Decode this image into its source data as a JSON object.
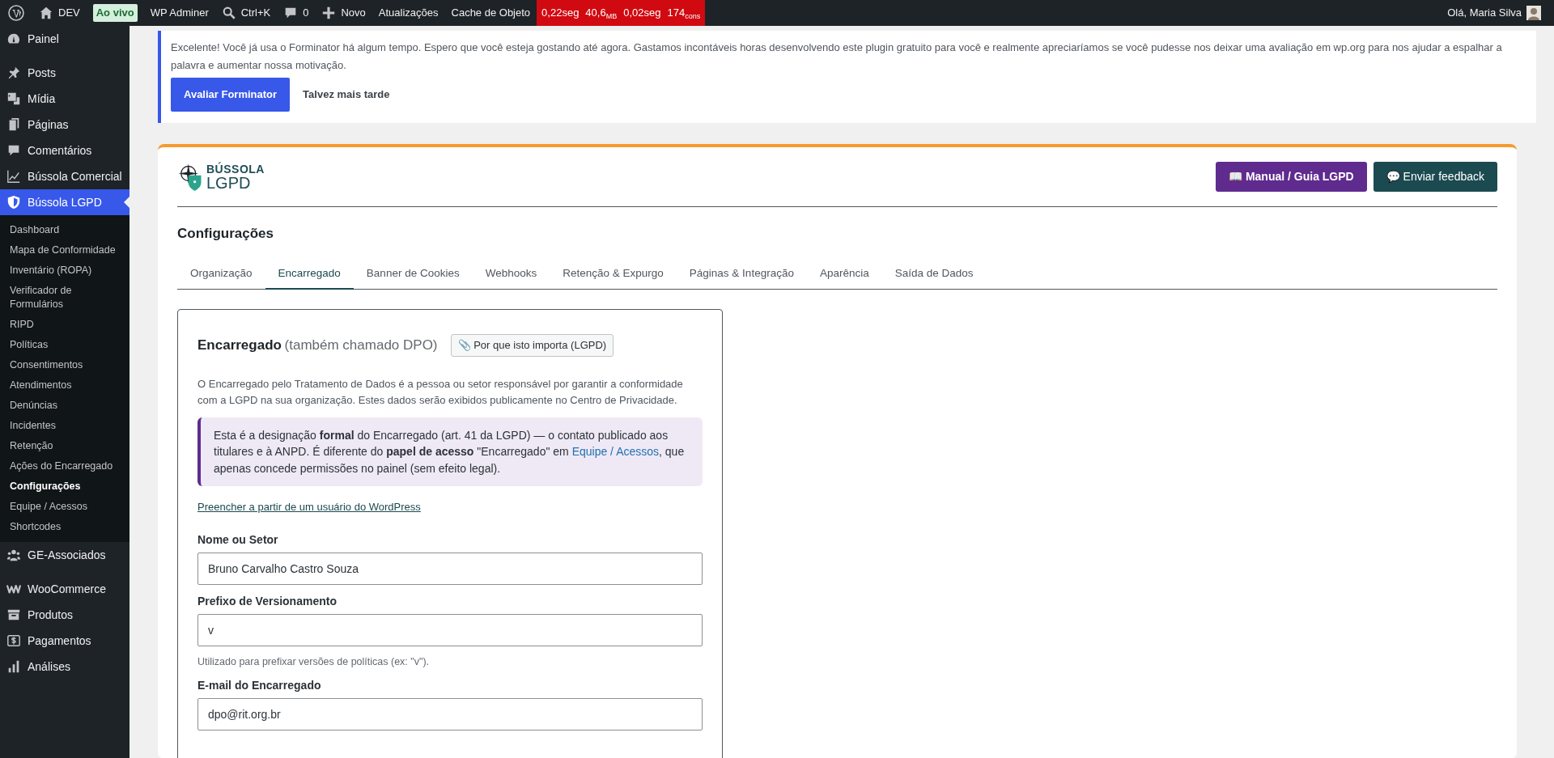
{
  "admin_bar": {
    "left": [
      {
        "kind": "wp-logo"
      },
      {
        "kind": "home",
        "label": "DEV"
      },
      {
        "kind": "badge",
        "label": "Ao vivo"
      },
      {
        "kind": "text",
        "label": "WP Adminer"
      },
      {
        "kind": "search",
        "label": "Ctrl+K"
      },
      {
        "kind": "comments",
        "label": "0"
      },
      {
        "kind": "new",
        "label": "Novo"
      },
      {
        "kind": "text",
        "label": "Atualizações"
      },
      {
        "kind": "text",
        "label": "Cache de Objeto"
      }
    ],
    "perf": [
      "0,22seg",
      "40,6$_{MB}$",
      "0,02seg",
      "174$_{cons}$"
    ],
    "greeting": "Olá, Maria Silva"
  },
  "sidebar": {
    "items": [
      {
        "label": "Painel",
        "selected": false
      },
      {
        "label": "Posts",
        "selected": false
      },
      {
        "label": "Mídia",
        "selected": false
      },
      {
        "label": "Páginas",
        "selected": false
      },
      {
        "label": "Comentários",
        "selected": false
      },
      {
        "label": "Bússola Comercial",
        "selected": false
      },
      {
        "label": "Bússola LGPD",
        "selected": true,
        "children": [
          {
            "label": "Dashboard",
            "selected": false
          },
          {
            "label": "Mapa de Conformidade",
            "selected": false
          },
          {
            "label": "Inventário (ROPA)",
            "selected": false
          },
          {
            "label": "Verificador de Formulários",
            "selected": false
          },
          {
            "label": "RIPD",
            "selected": false
          },
          {
            "label": "Políticas",
            "selected": false
          },
          {
            "label": "Consentimentos",
            "selected": false
          },
          {
            "label": "Atendimentos",
            "selected": false
          },
          {
            "label": "Denúncias",
            "selected": false
          },
          {
            "label": "Incidentes",
            "selected": false
          },
          {
            "label": "Retenção",
            "selected": false
          },
          {
            "label": "Ações do Encarregado",
            "selected": false
          },
          {
            "label": "Configurações",
            "selected": true
          },
          {
            "label": "Equipe / Acessos",
            "selected": false
          },
          {
            "label": "Shortcodes",
            "selected": false
          }
        ]
      },
      {
        "label": "GE-Associados",
        "selected": false
      },
      {
        "label": "WooCommerce",
        "selected": false
      },
      {
        "label": "Produtos",
        "selected": false
      },
      {
        "label": "Pagamentos",
        "selected": false
      },
      {
        "label": "Análises",
        "selected": false
      }
    ]
  },
  "notice": {
    "text": "Excelente! Você já usa o Forminator há algum tempo. Espero que você esteja gostando até agora. Gastamos incontáveis horas desenvolvendo este plugin gratuito para você e realmente apreciaríamos se você pudesse nos deixar uma avaliação em wp.org para nos ajudar a espalhar a palavra e aumentar nossa motivação.",
    "primary_button": "Avaliar Forminator",
    "secondary_link": "Talvez mais tarde"
  },
  "plugin": {
    "logo": {
      "line1": "BÚSSOLA",
      "line2": "LGPD"
    },
    "header_buttons": [
      {
        "kind": "manual",
        "label": "📖 Manual / Guia LGPD"
      },
      {
        "kind": "feedback",
        "label": "💬 Enviar feedback"
      }
    ],
    "page_title": "Configurações",
    "tabs": [
      {
        "label": "Organização",
        "selected": false
      },
      {
        "label": "Encarregado",
        "selected": true
      },
      {
        "label": "Banner de Cookies",
        "selected": false
      },
      {
        "label": "Webhooks",
        "selected": false
      },
      {
        "label": "Retenção & Expurgo",
        "selected": false
      },
      {
        "label": "Páginas & Integração",
        "selected": false
      },
      {
        "label": "Aparência",
        "selected": false
      },
      {
        "label": "Saída de Dados",
        "selected": false
      }
    ],
    "panel": {
      "title": "Encarregado",
      "subtitle": "(também chamado DPO)",
      "info_button": "📎 Por que isto importa (LGPD)",
      "description": "O Encarregado pelo Tratamento de Dados é a pessoa ou setor responsável por garantir a conformidade com a LGPD na sua organização. Estes dados serão exibidos publicamente no Centro de Privacidade.",
      "callout": {
        "before": "Esta é a designação **formal** do Encarregado (art. 41 da LGPD) — o contato publicado aos titulares e à ANPD. É diferente do **papel de acesso** \"Encarregado\" em",
        "link": "Equipe / Acessos",
        "after": ", que apenas concede permissões no painel (sem efeito legal)."
      },
      "fill_link": "Preencher a partir de um usuário do WordPress",
      "fields": [
        {
          "label": "Nome ou Setor",
          "value": "Bruno Carvalho Castro Souza"
        },
        {
          "label": "Prefixo de Versionamento",
          "value": "v",
          "help": "Utilizado para prefixar versões de políticas (ex: \"v\")."
        },
        {
          "label": "E-mail do Encarregado",
          "value": "dpo@rit.org.br"
        }
      ]
    }
  }
}
